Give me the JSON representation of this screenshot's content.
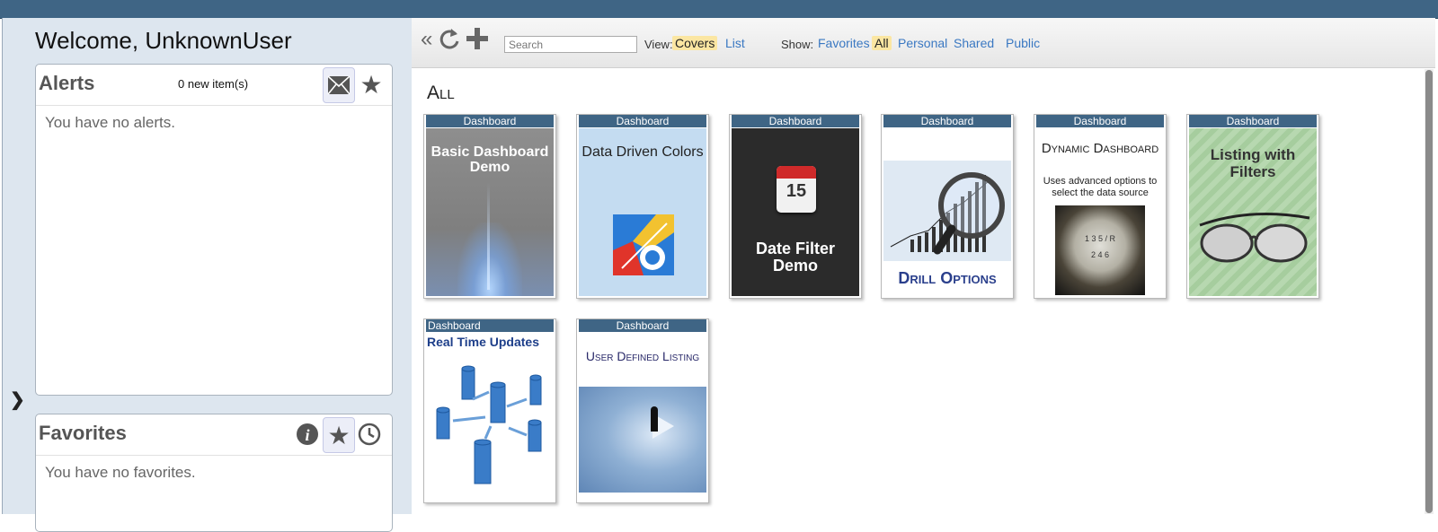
{
  "left": {
    "welcome": "Welcome, UnknownUser",
    "alerts": {
      "title": "Alerts",
      "count": "0 new item(s)",
      "empty": "You have no alerts.",
      "icons": [
        "envelope-icon",
        "star-icon"
      ]
    },
    "favorites": {
      "title": "Favorites",
      "empty": "You have no favorites.",
      "icons": [
        "info-icon",
        "star-icon",
        "clock-icon"
      ]
    }
  },
  "toolbar": {
    "search_placeholder": "Search",
    "view_label": "View:",
    "view_options": [
      "Covers",
      "List"
    ],
    "view_selected": "Covers",
    "show_label": "Show:",
    "show_options": [
      "Favorites",
      "All",
      "Personal",
      "Shared",
      "Public"
    ],
    "show_selected": "All"
  },
  "section": "All",
  "cards": [
    {
      "tag": "Dashboard",
      "title": "Basic Dashboard Demo"
    },
    {
      "tag": "Dashboard",
      "title": "Data Driven Colors"
    },
    {
      "tag": "Dashboard",
      "title": "Date Filter Demo",
      "calendar_day": "15"
    },
    {
      "tag": "Dashboard",
      "title": "Drill Options"
    },
    {
      "tag": "Dashboard",
      "title": "Dynamic Dashboard",
      "subtitle": "Uses advanced options to select the data source",
      "gear_labels": "1 3 5 / R 2 4 6"
    },
    {
      "tag": "Dashboard",
      "title": "Listing with Filters"
    },
    {
      "tag": "Dashboard",
      "title": "Real Time Updates"
    },
    {
      "tag": "Dashboard",
      "title": "User Defined Listing"
    }
  ],
  "colors": {
    "header": "#3f6585",
    "link": "#3a78c2",
    "highlight": "#fbe6a2"
  }
}
